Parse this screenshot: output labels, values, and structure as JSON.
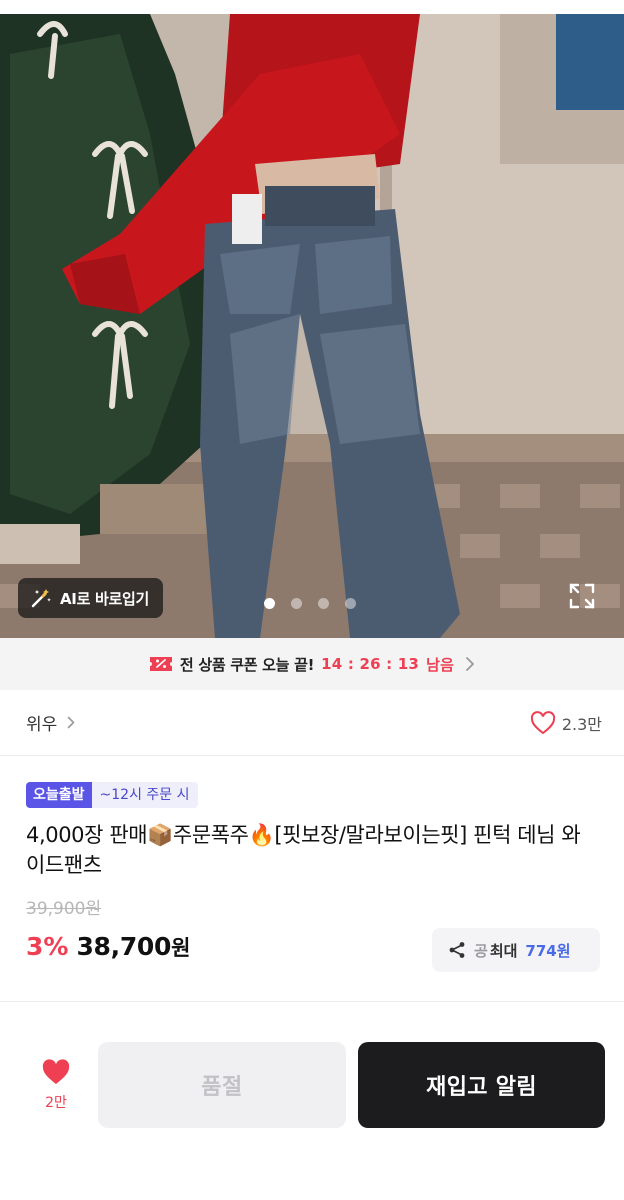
{
  "gallery": {
    "ai_button_label": "AI로 바로입기",
    "current_slide": 1,
    "total_slides": 4
  },
  "coupon_banner": {
    "text": "전 상품 쿠폰 오늘 끝!",
    "countdown": "14 : 26 : 13",
    "suffix": "남음"
  },
  "brand": {
    "name": "위우",
    "likes": "2.3만"
  },
  "product": {
    "badge": "오늘출발",
    "badge_note": "~12시 주문 시",
    "title": "4,000장 판매📦주문폭주🔥[핏보장/말라보이는핏] 핀턱 데님 와이드팬츠",
    "original_price": "39,900원",
    "discount": "3%",
    "price": "38,700",
    "currency": "원"
  },
  "share": {
    "prefix": "공",
    "max_label": "최대",
    "amount": "774원"
  },
  "bottom_bar": {
    "wish_count": "2만",
    "soldout_label": "품절",
    "restock_label": "재입고 알림"
  },
  "colors": {
    "accent_red": "#ee3f53",
    "badge_purple": "#5a55e6",
    "share_blue": "#4a6ae8",
    "dark_button": "#1c1c1e"
  },
  "icons": [
    "magic-wand-icon",
    "expand-icon",
    "coupon-ticket-icon",
    "chevron-right-icon",
    "heart-outline-icon",
    "share-icon",
    "heart-filled-icon"
  ]
}
